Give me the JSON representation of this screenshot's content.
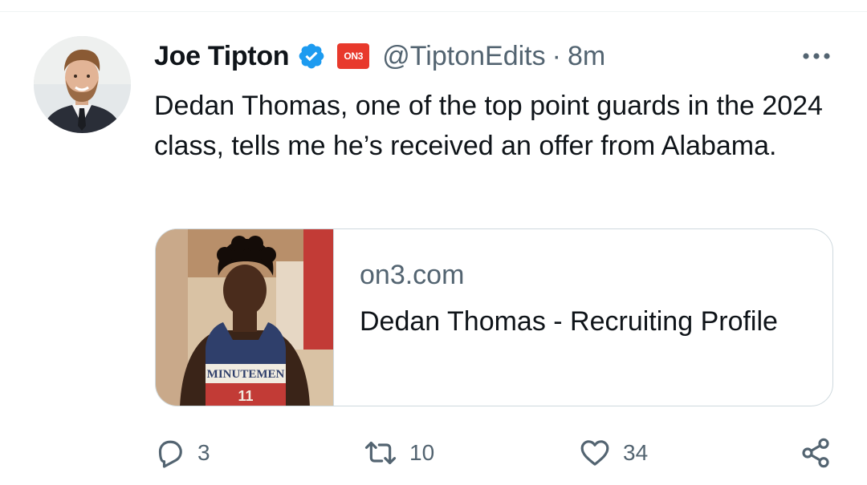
{
  "tweet": {
    "author": {
      "display_name": "Joe Tipton",
      "handle": "@TiptonEdits",
      "verified_icon": "verified-badge-icon",
      "affiliate_badge": "ON3",
      "brand_color": "#1d9bf0",
      "affiliate_color": "#e8392c"
    },
    "separator": "·",
    "time": "8m",
    "text": "Dedan Thomas, one of the top point guards in the 2024 class, tells me he’s received an offer from Alabama.",
    "card": {
      "domain": "on3.com",
      "title": "Dedan Thomas - Recruiting Profile",
      "image_jersey_text": "MINUTEMEN",
      "image_jersey_number": "11"
    },
    "actions": {
      "replies": "3",
      "retweets": "10",
      "likes": "34"
    },
    "icons": {
      "more": "more-horizontal-icon",
      "reply": "reply-icon",
      "retweet": "retweet-icon",
      "like": "heart-icon",
      "share": "share-icon"
    },
    "colors": {
      "text_primary": "#0f1419",
      "text_secondary": "#536471",
      "border": "#cfd9de"
    }
  }
}
